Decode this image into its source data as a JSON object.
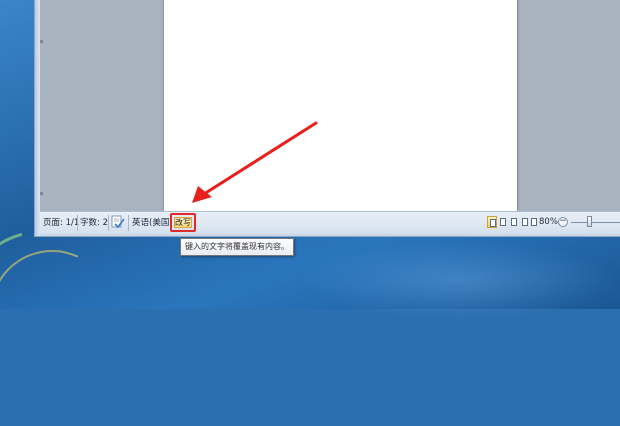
{
  "statusbar": {
    "page": "页面: 1/1",
    "word_count": "字数: 2",
    "proofing_icon": "proofing-check-icon",
    "language": "英语(美国)",
    "overtype_mode": "改写",
    "zoom": "80%",
    "zoom_minus": "−",
    "zoom_level_fraction": 0.3
  },
  "tooltip": {
    "text": "键入的文字将覆盖现有内容。"
  },
  "annotation": {
    "arrow_color": "#e8201c",
    "highlight_color": "#e12a2a"
  },
  "colors": {
    "statusbar_bg": "#dce6f2",
    "workspace_bg": "#a9b3bf",
    "desktop_bg": "#2c6fb0"
  }
}
